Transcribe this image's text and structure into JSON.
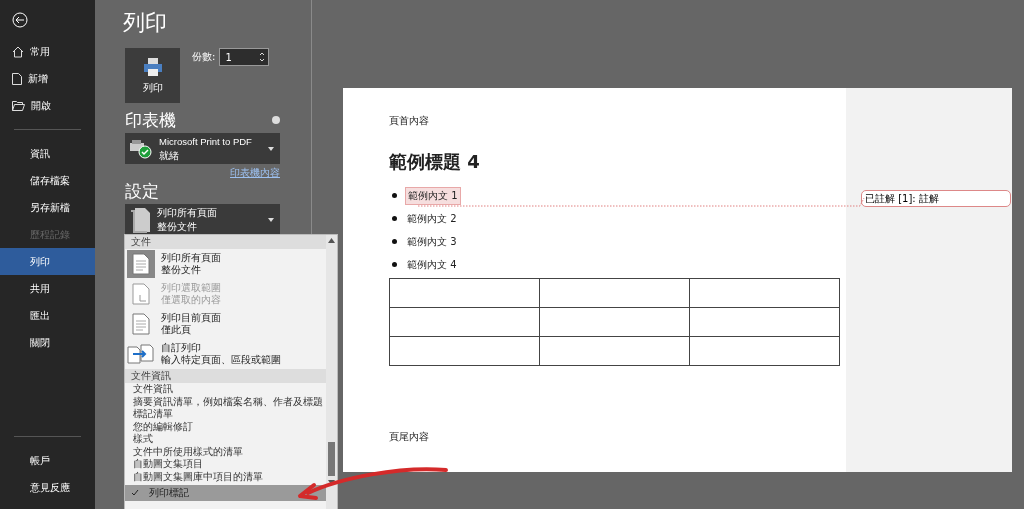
{
  "sidebar": {
    "top_items": [
      {
        "label": "常用"
      },
      {
        "label": "新增"
      },
      {
        "label": "開啟"
      }
    ],
    "items": [
      {
        "label": "資訊",
        "selected": false,
        "disabled": false
      },
      {
        "label": "儲存檔案",
        "selected": false,
        "disabled": false
      },
      {
        "label": "另存新檔",
        "selected": false,
        "disabled": false
      },
      {
        "label": "歷程記錄",
        "selected": false,
        "disabled": true
      },
      {
        "label": "列印",
        "selected": true,
        "disabled": false
      },
      {
        "label": "共用",
        "selected": false,
        "disabled": false
      },
      {
        "label": "匯出",
        "selected": false,
        "disabled": false
      },
      {
        "label": "關閉",
        "selected": false,
        "disabled": false
      }
    ],
    "bottom_items": [
      {
        "label": "帳戶"
      },
      {
        "label": "意見反應"
      }
    ]
  },
  "print_panel": {
    "title": "列印",
    "print_button": "列印",
    "copies": {
      "label": "份數:",
      "value": "1"
    },
    "printer": {
      "heading": "印表機",
      "name": "Microsoft Print to PDF",
      "status": "就緒",
      "properties_link": "印表機內容"
    },
    "settings": {
      "heading": "設定",
      "range": {
        "title": "列印所有頁面",
        "subtitle": "整份文件"
      }
    }
  },
  "range_menu": {
    "document_section": {
      "header": "文件",
      "options": [
        {
          "title": "列印所有頁面",
          "subtitle": "整份文件",
          "selected": true,
          "disabled": false
        },
        {
          "title": "列印選取範圍",
          "subtitle": "僅選取的內容",
          "selected": false,
          "disabled": true
        },
        {
          "title": "列印目前頁面",
          "subtitle": "僅此頁",
          "selected": false,
          "disabled": false
        },
        {
          "title": "自訂列印",
          "subtitle": "輸入特定頁面、區段或範圍",
          "selected": false,
          "disabled": false
        }
      ]
    },
    "info_section": {
      "header": "文件資訊",
      "items": [
        "文件資訊",
        "摘要資訊清單，例如檔案名稱、作者及標題",
        "標記清單",
        "您的編輯修訂",
        "樣式",
        "文件中所使用樣式的清單",
        "自動圖文集項目",
        "自動圖文集圖庫中項目的清單"
      ]
    },
    "print_markup": {
      "label": "列印標記",
      "checked": true
    }
  },
  "preview": {
    "header": "頁首內容",
    "heading": "範例標題 4",
    "bullets": [
      {
        "text": "範例內文 1",
        "commented": true
      },
      {
        "text": "範例內文 2",
        "commented": false
      },
      {
        "text": "範例內文 3",
        "commented": false
      },
      {
        "text": "範例內文 4",
        "commented": false
      }
    ],
    "footer": "頁尾內容",
    "comment": "已註解 [1]: 註解"
  }
}
